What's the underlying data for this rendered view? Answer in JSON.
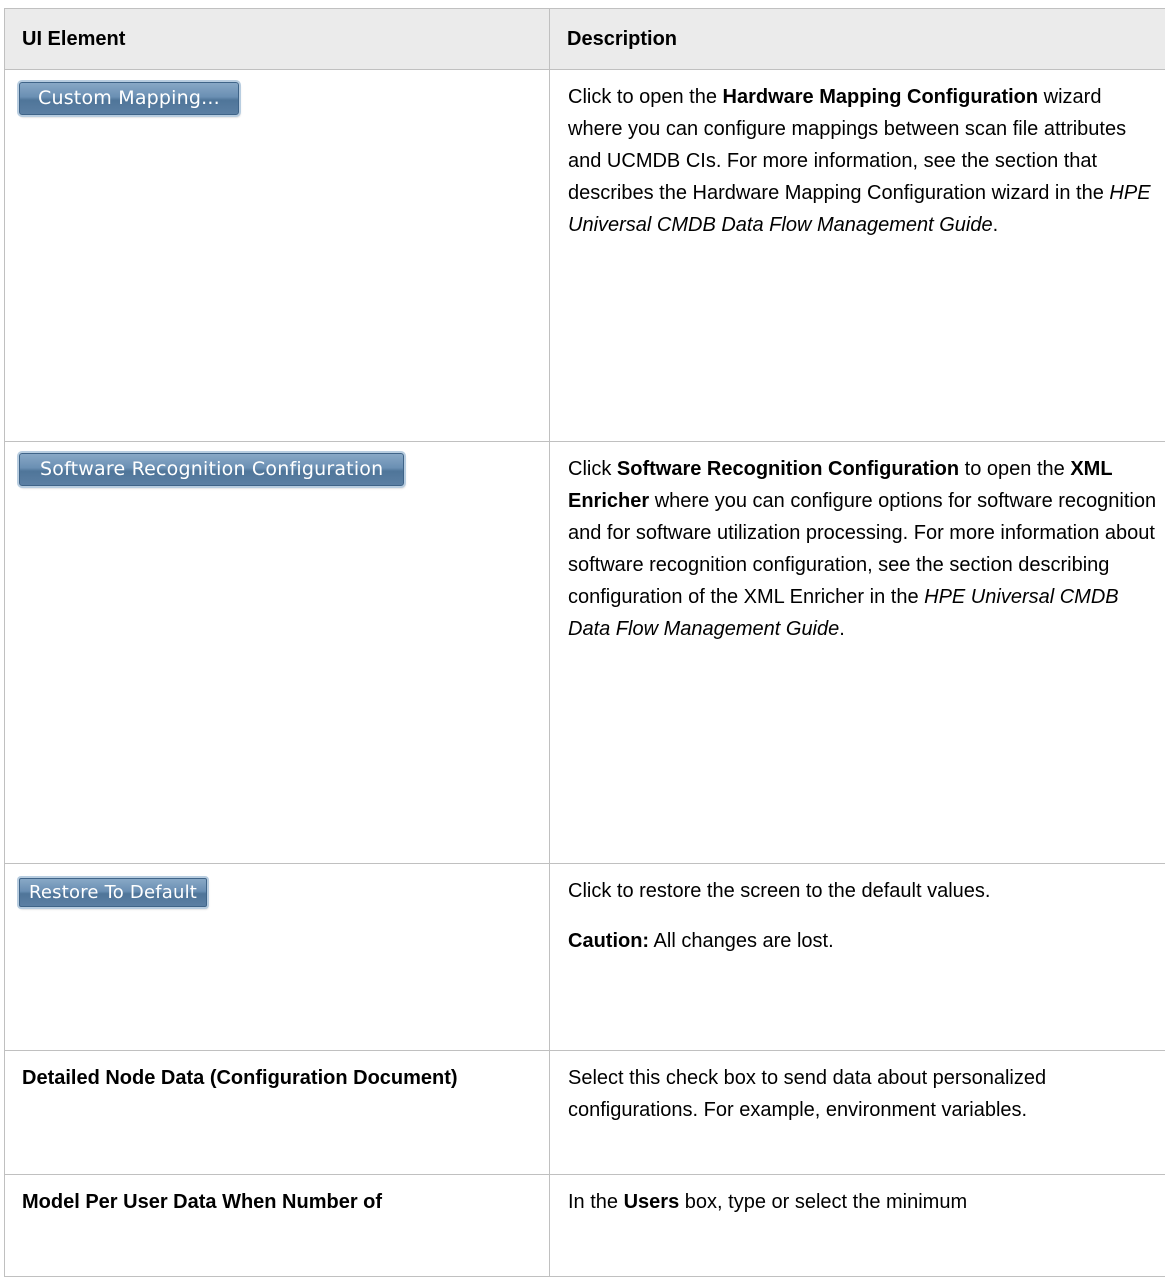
{
  "table": {
    "header_ui": "UI Element",
    "header_desc": "Description",
    "rows": [
      {
        "button": "Custom Mapping...",
        "desc": {
          "t1": "Click to open the ",
          "b1": "Hardware Mapping Configuration",
          "t2": " wizard where you can configure mappings between scan file attributes and UCMDB CIs. For more information, see the section that describes the Hardware Mapping Configuration wizard in the ",
          "i1": "HPE Universal CMDB Data Flow Management Guide",
          "t3": "."
        }
      },
      {
        "button": "Software Recognition Configuration",
        "desc": {
          "t1": "Click ",
          "b1": "Software Recognition Configuration",
          "t2": " to open the ",
          "b2": "XML Enricher",
          "t3": " where you can configure options for software recognition and for software utilization processing. For more information about software recognition configuration, see the section describing configuration of the XML Enricher in the ",
          "i1": "HPE Universal CMDB Data Flow Management Guide",
          "t4": "."
        }
      },
      {
        "button": "Restore To Default",
        "desc": {
          "p1": "Click to restore the screen to the default values.",
          "caution_label": "Caution:",
          "caution_text": " All changes are lost."
        }
      },
      {
        "label": "Detailed Node Data (Configuration Document)",
        "desc": {
          "text": "Select this check box to send data about personalized configurations. For example, environment variables."
        }
      },
      {
        "label": "Model Per User Data When Number of",
        "desc": {
          "t1": "In the ",
          "b1": "Users",
          "t2": " box, type or select the minimum"
        }
      }
    ]
  }
}
